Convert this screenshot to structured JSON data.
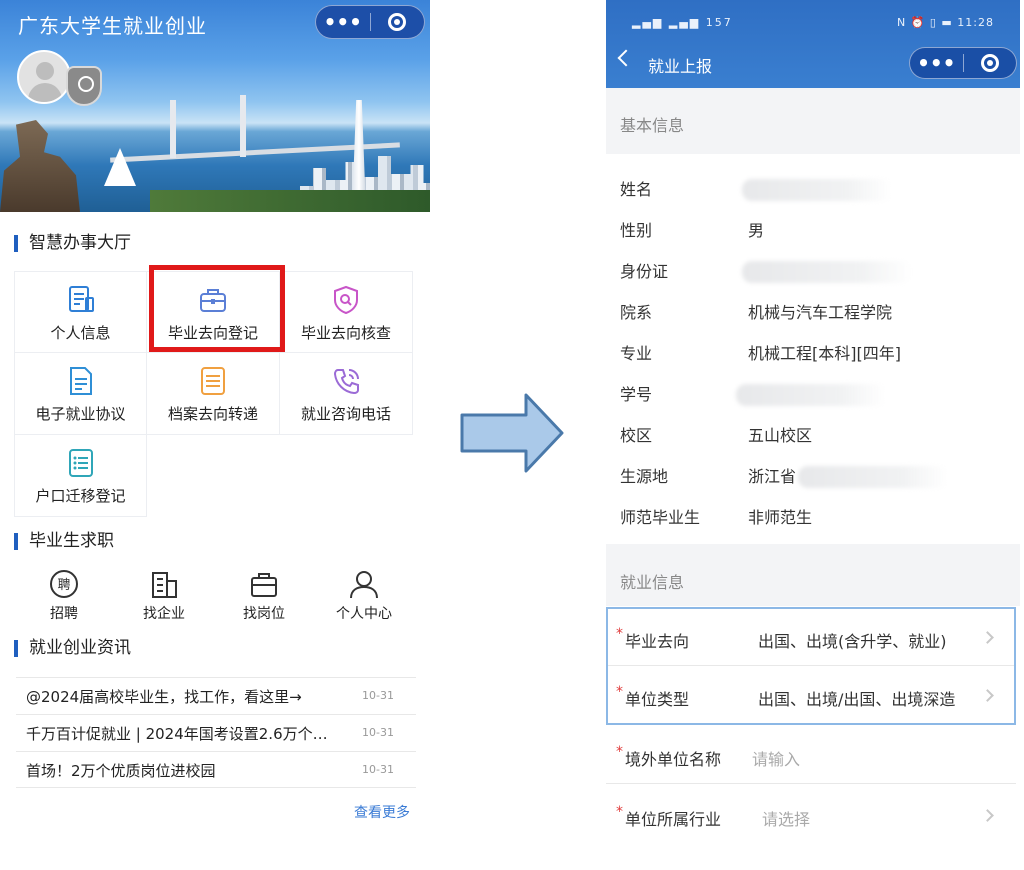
{
  "left_app": {
    "title": "广东大学生就业创业",
    "hall": {
      "title": "智慧办事大厅",
      "items": [
        {
          "label": "个人信息",
          "icon": "document-icon"
        },
        {
          "label": "毕业去向登记",
          "icon": "briefcase-icon"
        },
        {
          "label": "毕业去向核查",
          "icon": "shield-search-icon"
        },
        {
          "label": "电子就业协议",
          "icon": "contract-icon"
        },
        {
          "label": "档案去向转递",
          "icon": "archive-icon"
        },
        {
          "label": "就业咨询电话",
          "icon": "phone-icon"
        },
        {
          "label": "户口迁移登记",
          "icon": "list-icon"
        }
      ]
    },
    "jobs": {
      "title": "毕业生求职",
      "items": [
        {
          "label": "招聘",
          "icon": "recruit-icon"
        },
        {
          "label": "找企业",
          "icon": "building-icon"
        },
        {
          "label": "找岗位",
          "icon": "briefcase-icon"
        },
        {
          "label": "个人中心",
          "icon": "person-icon"
        }
      ]
    },
    "news": {
      "title": "就业创业资讯",
      "items": [
        {
          "text": "@2024届高校毕业生，找工作，看这里→",
          "date": "10-31"
        },
        {
          "text": "千万百计促就业 | 2024年国考设置2.6万个…",
          "date": "10-31"
        },
        {
          "text": "首场！2万个优质岗位进校园",
          "date": "10-31"
        }
      ],
      "more": "查看更多"
    }
  },
  "right_app": {
    "status": {
      "left": "▂▄▆ ▂▄▆ 157",
      "right": "N ⏰ ▯ ▬ 11:28"
    },
    "title": "就业上报",
    "basic_section": "基本信息",
    "basic": [
      {
        "key": "姓名",
        "value": ""
      },
      {
        "key": "性别",
        "value": "男"
      },
      {
        "key": "身份证",
        "value": ""
      },
      {
        "key": "院系",
        "value": "机械与汽车工程学院"
      },
      {
        "key": "专业",
        "value": "机械工程[本科][四年]"
      },
      {
        "key": "学号",
        "value": ""
      },
      {
        "key": "校区",
        "value": "五山校区"
      },
      {
        "key": "生源地",
        "value": "浙江省"
      },
      {
        "key": "师范毕业生",
        "value": "非师范生"
      }
    ],
    "employment_section": "就业信息",
    "employment": [
      {
        "key": "毕业去向",
        "value": "出国、出境(含升学、就业)",
        "required": "*"
      },
      {
        "key": "单位类型",
        "value": "出国、出境/出国、出境深造",
        "required": "*"
      },
      {
        "key": "境外单位名称",
        "placeholder": "请输入",
        "required": "*"
      },
      {
        "key": "单位所属行业",
        "placeholder": "请选择",
        "required": "*"
      }
    ]
  },
  "colors": {
    "accent": "#1f5fbf",
    "highlight": "#e01919",
    "header": "#2f6fc4"
  }
}
